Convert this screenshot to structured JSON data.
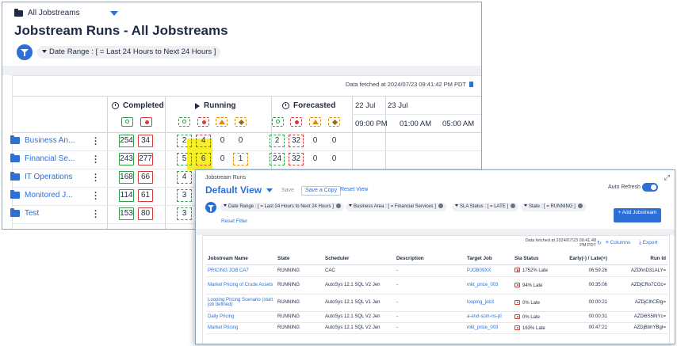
{
  "back": {
    "breadcrumb": "All Jobstreams",
    "title": "Jobstream Runs - All Jobstreams",
    "filter_chip": "Date Range : [ = Last 24 Hours to Next 24 Hours ]",
    "fetched": "Data fetched at 2024/07/23 09:41:42 PM PDT",
    "groups": {
      "completed": "Completed",
      "running": "Running",
      "forecasted": "Forecasted"
    },
    "dates": [
      "22 Jul",
      "23 Jul"
    ],
    "times": [
      "09:00 PM",
      "01:00 AM",
      "05:00 AM"
    ],
    "rows": [
      {
        "name": "Business An...",
        "c_ok": "254",
        "c_err": "34",
        "r_ok": "2",
        "r_err": "4",
        "r_warn": "0",
        "r_late": "0",
        "f_ok": "2",
        "f_err": "32",
        "f_warn": "0",
        "f_late": "0"
      },
      {
        "name": "Financial Se...",
        "c_ok": "243",
        "c_err": "277",
        "r_ok": "5",
        "r_err": "6",
        "r_warn": "0",
        "r_late": "1",
        "f_ok": "24",
        "f_err": "32",
        "f_warn": "0",
        "f_late": "0"
      },
      {
        "name": "IT Operations",
        "c_ok": "168",
        "c_err": "66",
        "r_ok": "4"
      },
      {
        "name": "Monitored J...",
        "c_ok": "114",
        "c_err": "61",
        "r_ok": "3"
      },
      {
        "name": "Test",
        "c_ok": "153",
        "c_err": "80",
        "r_ok": "3"
      }
    ]
  },
  "front": {
    "subtitle": "Jobstream Runs",
    "view": "Default View",
    "save": "Save",
    "save_copy": "Save a Copy",
    "reset_view": "Reset View",
    "auto_refresh": "Auto Refresh",
    "chips": [
      "Date Range : [ = Last 24 Hours to Next 24 Hours ]",
      "Business Area : [ = Financial Services ]",
      "SLA Status : [ = LATE ]",
      "State : [ = RUNNING ]"
    ],
    "reset_filter": "Reset Filter",
    "add_button": "+ Add Jobstream",
    "fetched": "Data fetched at 2024/07/23 09:41:48 PM PDT",
    "columns": "Columns",
    "export": "Export",
    "headers": [
      "Jobstream Name",
      "State",
      "Scheduler",
      "Description",
      "Target Job",
      "Sla Status",
      "Early(-) / Late(+)",
      "Run Id"
    ],
    "rows": [
      [
        "PRICING JOB CA7",
        "RUNNING",
        "CAC",
        "-",
        "PJOB09XX",
        "1752% Late",
        "06:59:26",
        "AZDhnD31ALY="
      ],
      [
        "Market Pricing of Crude Assets",
        "RUNNING",
        "AutoSys 12.1 SQL V2 Jen",
        "-",
        "mkt_price_003",
        "94% Late",
        "00:35:06",
        "AZDjCRo7CGc="
      ],
      [
        "Looping Pricing Scenario (start job defined)",
        "RUNNING",
        "AutoSys 12.1 SQL V1 Jen",
        "-",
        "looping_job3",
        "0% Late",
        "00:00:21",
        "AZDjClhCEtg="
      ],
      [
        "Daily Pricing",
        "RUNNING",
        "AutoSys 12.1 SQL V2 Jen",
        "-",
        "a-end-som-ns-pl",
        "0% Late",
        "00:00:31",
        "AZDi6S5lNYc="
      ],
      [
        "Market Pricing",
        "RUNNING",
        "AutoSys 12.1 SQL V2 Jen",
        "-",
        "mkt_price_003",
        "163% Late",
        "00:47:21",
        "AZDjBbhYBgI="
      ]
    ]
  }
}
